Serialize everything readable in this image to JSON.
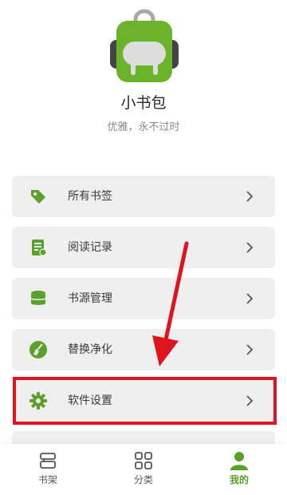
{
  "app": {
    "name": "小书包",
    "slogan": "优雅，永不过时"
  },
  "menu": {
    "items": [
      {
        "label": "所有书签",
        "icon": "tag-icon"
      },
      {
        "label": "阅读记录",
        "icon": "reading-record-icon"
      },
      {
        "label": "书源管理",
        "icon": "database-icon"
      },
      {
        "label": "替换净化",
        "icon": "broom-icon"
      },
      {
        "label": "软件设置",
        "icon": "gear-icon"
      }
    ]
  },
  "bottom_nav": {
    "items": [
      {
        "label": "书架",
        "icon": "bookshelf-icon"
      },
      {
        "label": "分类",
        "icon": "grid-icon"
      },
      {
        "label": "我的",
        "icon": "person-icon",
        "active": true
      }
    ]
  },
  "colors": {
    "accent": "#5aa02c",
    "highlight": "#e0141e"
  }
}
